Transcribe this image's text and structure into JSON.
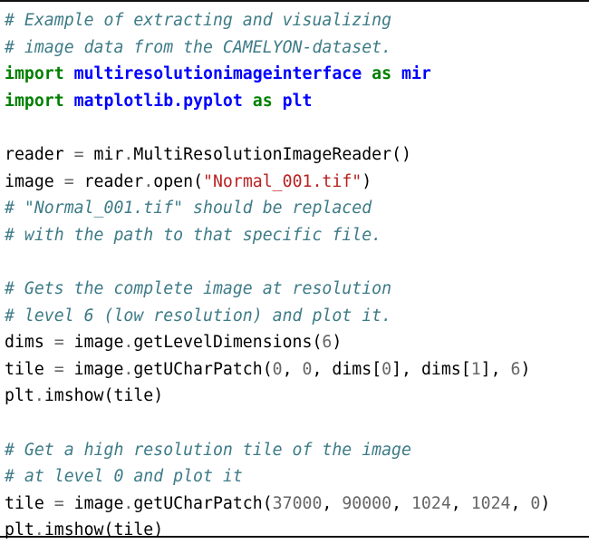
{
  "listing": {
    "language": "python",
    "colors": {
      "background": "#ffffff",
      "default_text": "#000000",
      "comment": "#3D7B87",
      "keyword": "#008000",
      "namespace": "#0000FF",
      "string": "#BA2121",
      "number": "#666666",
      "operator": "#666666",
      "frame_rule": "#111111"
    },
    "lines": [
      {
        "index": 1,
        "text": "# Example of extracting and visualizing",
        "tokens": [
          {
            "t": "# Example of extracting and visualizing",
            "k": "comment"
          }
        ]
      },
      {
        "index": 2,
        "text": "# image data from the CAMELYON-dataset.",
        "tokens": [
          {
            "t": "# image data from the CAMELYON-dataset.",
            "k": "comment"
          }
        ]
      },
      {
        "index": 3,
        "text": "import multiresolutionimageinterface as mir",
        "tokens": [
          {
            "t": "import",
            "k": "keyword"
          },
          {
            "t": " ",
            "k": "text"
          },
          {
            "t": "multiresolutionimageinterface",
            "k": "namespace"
          },
          {
            "t": " ",
            "k": "text"
          },
          {
            "t": "as",
            "k": "keyword"
          },
          {
            "t": " ",
            "k": "text"
          },
          {
            "t": "mir",
            "k": "namespace"
          }
        ]
      },
      {
        "index": 4,
        "text": "import matplotlib.pyplot as plt",
        "tokens": [
          {
            "t": "import",
            "k": "keyword"
          },
          {
            "t": " ",
            "k": "text"
          },
          {
            "t": "matplotlib.pyplot",
            "k": "namespace"
          },
          {
            "t": " ",
            "k": "text"
          },
          {
            "t": "as",
            "k": "keyword"
          },
          {
            "t": " ",
            "k": "text"
          },
          {
            "t": "plt",
            "k": "namespace"
          }
        ]
      },
      {
        "index": 5,
        "text": "",
        "tokens": []
      },
      {
        "index": 6,
        "text": "reader = mir.MultiResolutionImageReader()",
        "tokens": [
          {
            "t": "reader ",
            "k": "text"
          },
          {
            "t": "=",
            "k": "operator"
          },
          {
            "t": " mir",
            "k": "text"
          },
          {
            "t": ".",
            "k": "operator"
          },
          {
            "t": "MultiResolutionImageReader()",
            "k": "text"
          }
        ]
      },
      {
        "index": 7,
        "text": "image = reader.open(\"Normal_001.tif\")",
        "tokens": [
          {
            "t": "image ",
            "k": "text"
          },
          {
            "t": "=",
            "k": "operator"
          },
          {
            "t": " reader",
            "k": "text"
          },
          {
            "t": ".",
            "k": "operator"
          },
          {
            "t": "open(",
            "k": "text"
          },
          {
            "t": "\"Normal_001.tif\"",
            "k": "string"
          },
          {
            "t": ")",
            "k": "text"
          }
        ]
      },
      {
        "index": 8,
        "text": "# \"Normal_001.tif\" should be replaced",
        "tokens": [
          {
            "t": "# \"Normal_001.tif\" should be replaced",
            "k": "comment"
          }
        ]
      },
      {
        "index": 9,
        "text": "# with the path to that specific file.",
        "tokens": [
          {
            "t": "# with the path to that specific file.",
            "k": "comment"
          }
        ]
      },
      {
        "index": 10,
        "text": "",
        "tokens": []
      },
      {
        "index": 11,
        "text": "# Gets the complete image at resolution",
        "tokens": [
          {
            "t": "# Gets the complete image at resolution",
            "k": "comment"
          }
        ]
      },
      {
        "index": 12,
        "text": "# level 6 (low resolution) and plot it.",
        "tokens": [
          {
            "t": "# level 6 (low resolution) and plot it.",
            "k": "comment"
          }
        ]
      },
      {
        "index": 13,
        "text": "dims = image.getLevelDimensions(6)",
        "tokens": [
          {
            "t": "dims ",
            "k": "text"
          },
          {
            "t": "=",
            "k": "operator"
          },
          {
            "t": " image",
            "k": "text"
          },
          {
            "t": ".",
            "k": "operator"
          },
          {
            "t": "getLevelDimensions(",
            "k": "text"
          },
          {
            "t": "6",
            "k": "number"
          },
          {
            "t": ")",
            "k": "text"
          }
        ]
      },
      {
        "index": 14,
        "text": "tile = image.getUCharPatch(0, 0, dims[0], dims[1], 6)",
        "tokens": [
          {
            "t": "tile ",
            "k": "text"
          },
          {
            "t": "=",
            "k": "operator"
          },
          {
            "t": " image",
            "k": "text"
          },
          {
            "t": ".",
            "k": "operator"
          },
          {
            "t": "getUCharPatch(",
            "k": "text"
          },
          {
            "t": "0",
            "k": "number"
          },
          {
            "t": ", ",
            "k": "text"
          },
          {
            "t": "0",
            "k": "number"
          },
          {
            "t": ", dims[",
            "k": "text"
          },
          {
            "t": "0",
            "k": "number"
          },
          {
            "t": "], dims[",
            "k": "text"
          },
          {
            "t": "1",
            "k": "number"
          },
          {
            "t": "], ",
            "k": "text"
          },
          {
            "t": "6",
            "k": "number"
          },
          {
            "t": ")",
            "k": "text"
          }
        ]
      },
      {
        "index": 15,
        "text": "plt.imshow(tile)",
        "tokens": [
          {
            "t": "plt",
            "k": "text"
          },
          {
            "t": ".",
            "k": "operator"
          },
          {
            "t": "imshow(tile)",
            "k": "text"
          }
        ]
      },
      {
        "index": 16,
        "text": "",
        "tokens": []
      },
      {
        "index": 17,
        "text": "# Get a high resolution tile of the image",
        "tokens": [
          {
            "t": "# Get a high resolution tile of the image",
            "k": "comment"
          }
        ]
      },
      {
        "index": 18,
        "text": "# at level 0 and plot it",
        "tokens": [
          {
            "t": "# at level 0 and plot it",
            "k": "comment"
          }
        ]
      },
      {
        "index": 19,
        "text": "tile = image.getUCharPatch(37000, 90000, 1024, 1024, 0)",
        "tokens": [
          {
            "t": "tile ",
            "k": "text"
          },
          {
            "t": "=",
            "k": "operator"
          },
          {
            "t": " image",
            "k": "text"
          },
          {
            "t": ".",
            "k": "operator"
          },
          {
            "t": "getUCharPatch(",
            "k": "text"
          },
          {
            "t": "37000",
            "k": "number"
          },
          {
            "t": ", ",
            "k": "text"
          },
          {
            "t": "90000",
            "k": "number"
          },
          {
            "t": ", ",
            "k": "text"
          },
          {
            "t": "1024",
            "k": "number"
          },
          {
            "t": ", ",
            "k": "text"
          },
          {
            "t": "1024",
            "k": "number"
          },
          {
            "t": ", ",
            "k": "text"
          },
          {
            "t": "0",
            "k": "number"
          },
          {
            "t": ")",
            "k": "text"
          }
        ]
      },
      {
        "index": 20,
        "text": "plt.imshow(tile)",
        "tokens": [
          {
            "t": "plt",
            "k": "text"
          },
          {
            "t": ".",
            "k": "operator"
          },
          {
            "t": "imshow(tile)",
            "k": "text"
          }
        ]
      }
    ]
  }
}
